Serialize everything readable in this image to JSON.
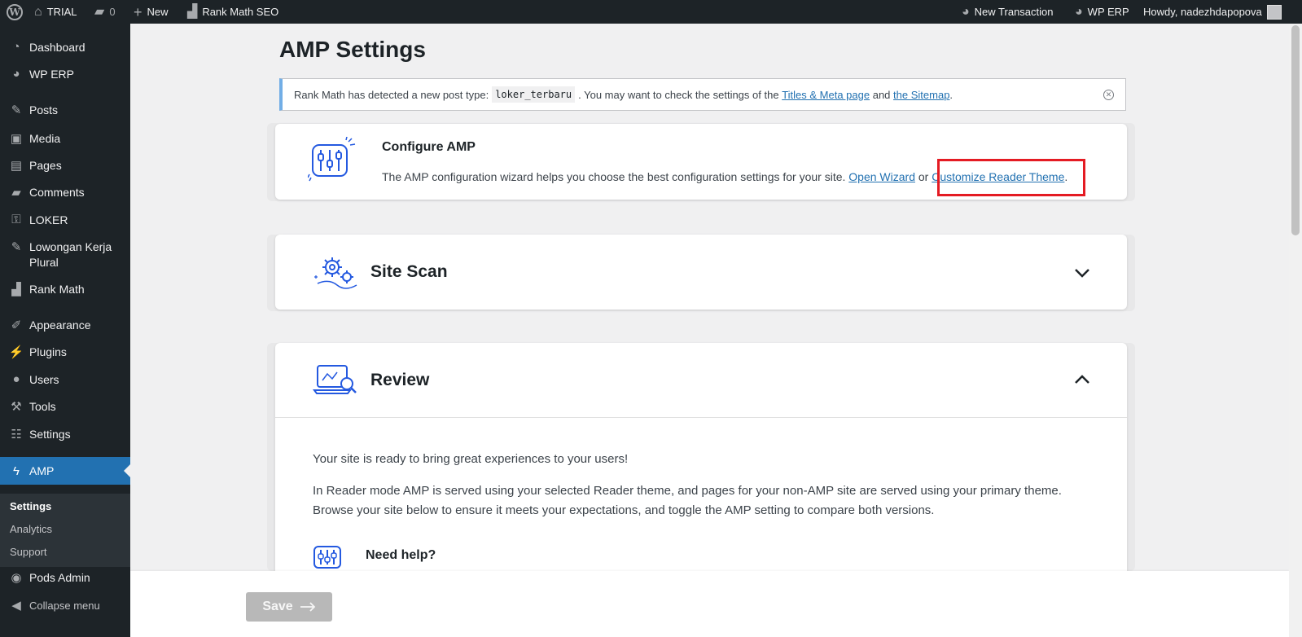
{
  "adminbar": {
    "site_name": "TRIAL",
    "comments_count": "0",
    "new_label": "New",
    "rank_math_label": "Rank Math SEO",
    "new_transaction_label": "New Transaction",
    "wp_erp_label": "WP ERP",
    "howdy_label": "Howdy, nadezhdapopova"
  },
  "sidebar": {
    "items": [
      {
        "label": "Dashboard",
        "icon": "dashboard-icon"
      },
      {
        "label": "WP ERP",
        "icon": "erp-icon"
      },
      {
        "label": "Posts",
        "icon": "pin-icon"
      },
      {
        "label": "Media",
        "icon": "media-icon"
      },
      {
        "label": "Pages",
        "icon": "pages-icon"
      },
      {
        "label": "Comments",
        "icon": "comment-icon"
      },
      {
        "label": "LOKER",
        "icon": "wrench-icon"
      },
      {
        "label": "Lowongan Kerja Plural",
        "icon": "pin-icon"
      },
      {
        "label": "Rank Math",
        "icon": "rank-math-icon"
      },
      {
        "label": "Appearance",
        "icon": "brush-icon"
      },
      {
        "label": "Plugins",
        "icon": "plugin-icon"
      },
      {
        "label": "Users",
        "icon": "user-icon"
      },
      {
        "label": "Tools",
        "icon": "tools-icon"
      },
      {
        "label": "Settings",
        "icon": "settings-icon"
      },
      {
        "label": "AMP",
        "icon": "amp-icon"
      },
      {
        "label": "Pods Admin",
        "icon": "pods-icon"
      },
      {
        "label": "Collapse menu",
        "icon": "collapse-icon"
      }
    ],
    "submenu": [
      "Settings",
      "Analytics",
      "Support"
    ]
  },
  "page": {
    "title": "AMP Settings"
  },
  "notice": {
    "text_before": "Rank Math has detected a new post type:",
    "code": "loker_terbaru",
    "text_middle": ". You may want to check the settings of the",
    "link1": "Titles & Meta page",
    "text_and": "and",
    "link2": "the Sitemap",
    "text_end": "."
  },
  "configure": {
    "title": "Configure AMP",
    "desc": "The AMP configuration wizard helps you choose the best configuration settings for your site.",
    "link_wizard": "Open Wizard",
    "or": "or",
    "link_customize": "Customize Reader Theme",
    "end": "."
  },
  "site_scan": {
    "title": "Site Scan"
  },
  "review": {
    "title": "Review",
    "ready_text": "Your site is ready to bring great experiences to your users!",
    "reader_line1": "In Reader mode AMP is served using your selected Reader theme, and pages for your non-AMP site are served using your primary theme.",
    "reader_line2": "Browse your site below to ensure it meets your expectations, and toggle the AMP setting to compare both versions.",
    "help_title": "Need help?"
  },
  "footer": {
    "save_label": "Save"
  },
  "colors": {
    "accent": "#2271b1",
    "admin_dark": "#1d2327",
    "highlight_red": "#e41b23",
    "amp_icon_blue": "#2459e0"
  }
}
